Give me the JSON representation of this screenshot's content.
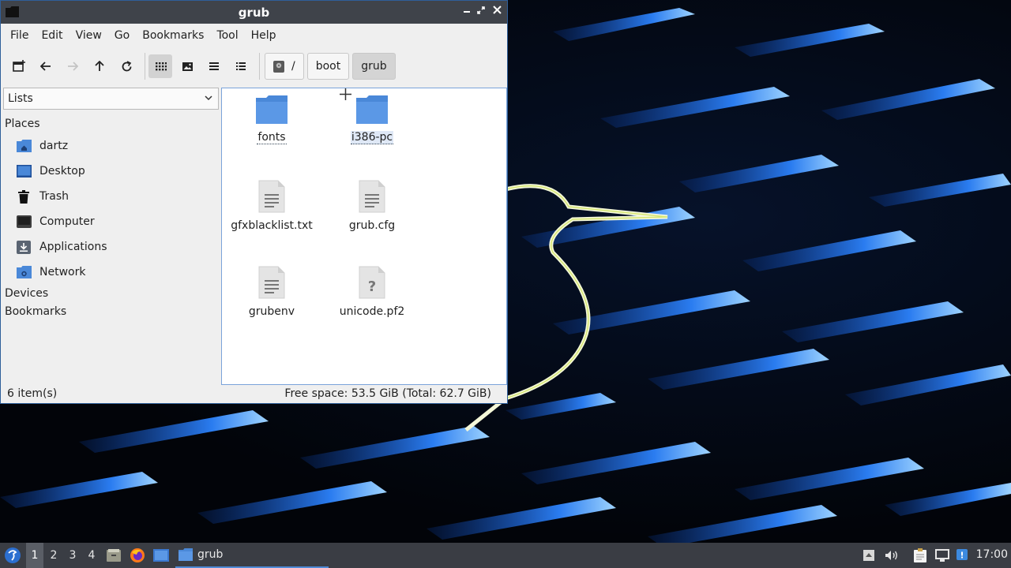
{
  "window": {
    "title": "grub",
    "controls": {
      "minimize": "‒",
      "maximize": "⤢",
      "close": "✕"
    }
  },
  "menu": [
    "File",
    "Edit",
    "View",
    "Go",
    "Bookmarks",
    "Tool",
    "Help"
  ],
  "path": {
    "root": "/",
    "crumbs": [
      "boot",
      "grub"
    ],
    "current": "grub"
  },
  "sidebar": {
    "mode": "Lists",
    "places_header": "Places",
    "places": [
      {
        "label": "dartz",
        "icon": "home-folder-icon"
      },
      {
        "label": "Desktop",
        "icon": "desktop-icon"
      },
      {
        "label": "Trash",
        "icon": "trash-icon"
      },
      {
        "label": "Computer",
        "icon": "computer-icon"
      },
      {
        "label": "Applications",
        "icon": "applications-icon"
      },
      {
        "label": "Network",
        "icon": "network-icon"
      }
    ],
    "devices_header": "Devices",
    "bookmarks_header": "Bookmarks"
  },
  "files": [
    {
      "name": "fonts",
      "type": "folder",
      "state": "focused"
    },
    {
      "name": "i386-pc",
      "type": "folder",
      "state": "selected"
    },
    {
      "name": "gfxblacklist.txt",
      "type": "text"
    },
    {
      "name": "grub.cfg",
      "type": "text"
    },
    {
      "name": "grubenv",
      "type": "text"
    },
    {
      "name": "unicode.pf2",
      "type": "unknown"
    }
  ],
  "status": {
    "items": "6 item(s)",
    "free_space": "Free space: 53.5 GiB (Total: 62.7 GiB)"
  },
  "taskbar": {
    "workspaces": [
      "1",
      "2",
      "3",
      "4"
    ],
    "active_workspace": "1",
    "task_label": "grub",
    "clock": "17:00"
  },
  "colors": {
    "accent": "#4f8ad6",
    "folder": "#4a88d8",
    "titlebar": "#3f434a",
    "taskbar": "#3a3d44"
  }
}
